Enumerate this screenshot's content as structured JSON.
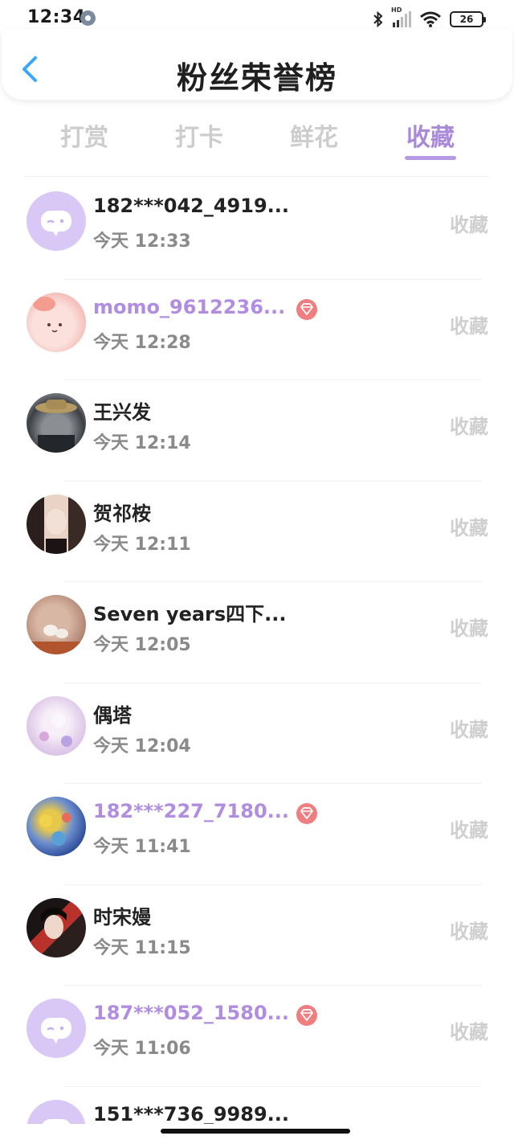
{
  "status_bar": {
    "time": "12:34",
    "network_label": "HD",
    "battery": "26"
  },
  "header": {
    "title": "粉丝荣誉榜"
  },
  "tabs": [
    {
      "label": "打赏",
      "active": false
    },
    {
      "label": "打卡",
      "active": false
    },
    {
      "label": "鲜花",
      "active": false
    },
    {
      "label": "收藏",
      "active": true
    }
  ],
  "rows": [
    {
      "name": "182***042_4919...",
      "time": "今天 12:33",
      "action": "收藏",
      "vip": false,
      "avatar": "chat-bubble-avatar"
    },
    {
      "name": "momo_9612236...",
      "time": "今天 12:28",
      "action": "收藏",
      "vip": true,
      "avatar": "pink-cartoon-avatar"
    },
    {
      "name": "王兴发",
      "time": "今天 12:14",
      "action": "收藏",
      "vip": false,
      "avatar": "cat-photo-avatar"
    },
    {
      "name": "贺祁桉",
      "time": "今天 12:11",
      "action": "收藏",
      "vip": false,
      "avatar": "portrait-avatar"
    },
    {
      "name": "Seven years四下...",
      "time": "今天 12:05",
      "action": "收藏",
      "vip": false,
      "avatar": "paw-photo-avatar"
    },
    {
      "name": "偶塔",
      "time": "今天 12:04",
      "action": "收藏",
      "vip": false,
      "avatar": "anime-avatar"
    },
    {
      "name": "182***227_7180...",
      "time": "今天 11:41",
      "action": "收藏",
      "vip": true,
      "avatar": "painting-avatar"
    },
    {
      "name": "时宋嫚",
      "time": "今天 11:15",
      "action": "收藏",
      "vip": false,
      "avatar": "portrait-avatar-2"
    },
    {
      "name": "187***052_1580...",
      "time": "今天 11:06",
      "action": "收藏",
      "vip": true,
      "avatar": "chat-bubble-avatar"
    },
    {
      "name": "151***736_9989...",
      "time": "",
      "action": "",
      "vip": false,
      "avatar": "chat-bubble-avatar"
    }
  ],
  "colors": {
    "accent": "#a98ad8",
    "vip_badge": "#f07d80",
    "muted": "#cfcfcf"
  }
}
